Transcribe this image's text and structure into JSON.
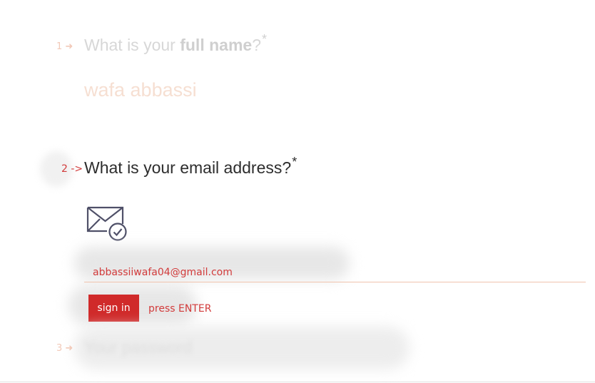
{
  "question1": {
    "number": "1",
    "arrow": "➜",
    "title_prefix": "What is your ",
    "title_bold": "full name",
    "title_suffix": "?",
    "required_mark": "*",
    "answer": "wafa abbassi"
  },
  "question2": {
    "number": "2",
    "arrow": "->",
    "title": "What is your email address?",
    "required_mark": "*",
    "icon": "envelope-check-icon",
    "email_value": "abbassiiwafa04@gmail.com",
    "submit_label": "sign in",
    "hint": "press ENTER"
  },
  "question3": {
    "number": "3",
    "arrow": "➜",
    "title": "Your password"
  },
  "colors": {
    "accent": "#d02a2a",
    "active_text": "#2d2d2d",
    "faded_text": "#d7d7d7",
    "faded_number": "#f2c9b8",
    "input_underline": "#f0c3ad"
  }
}
